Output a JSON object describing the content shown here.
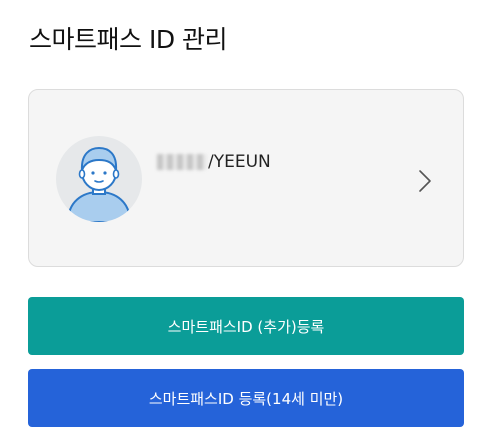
{
  "header": {
    "title": "스마트패스 ID 관리"
  },
  "profile": {
    "user_id_visible": "/YEEUN",
    "avatar_icon": "user-avatar-icon",
    "chevron_icon": "chevron-right-icon"
  },
  "buttons": {
    "add_label": "스마트패스ID (추가)등록",
    "minor_label": "스마트패스ID 등록(14세 미만)"
  },
  "colors": {
    "add_button": "#0b9d98",
    "minor_button": "#2563d9",
    "card_background": "#f5f5f5",
    "avatar_blue": "#2c78c8",
    "avatar_light_blue": "#a9cdee"
  }
}
